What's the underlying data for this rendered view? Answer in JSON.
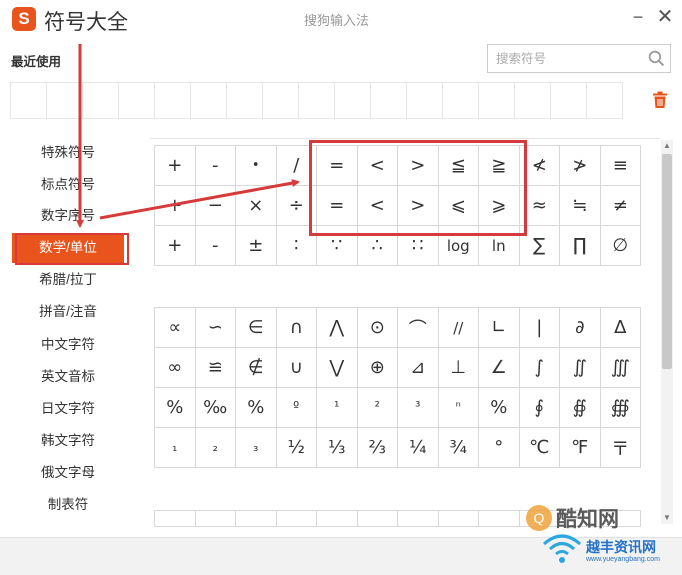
{
  "window": {
    "logo_letter": "S",
    "title": "符号大全",
    "subtitle": "搜狗输入法",
    "minimize_glyph": "−",
    "close_glyph": "✕"
  },
  "recent": {
    "label": "最近使用",
    "slot_count": 17,
    "clear_icon": "trash-icon"
  },
  "search": {
    "placeholder": "搜索符号",
    "value": "",
    "icon": "search-icon"
  },
  "sidebar": {
    "items": [
      {
        "label": "特殊符号"
      },
      {
        "label": "标点符号"
      },
      {
        "label": "数字序号"
      },
      {
        "label": "数学/单位",
        "active": true
      },
      {
        "label": "希腊/拉丁"
      },
      {
        "label": "拼音/注音"
      },
      {
        "label": "中文字符"
      },
      {
        "label": "英文音标"
      },
      {
        "label": "日文字符"
      },
      {
        "label": "韩文字符"
      },
      {
        "label": "俄文字母"
      },
      {
        "label": "制表符"
      }
    ]
  },
  "symbols": {
    "group1": [
      "+",
      "-",
      "•",
      "/",
      "=",
      "<",
      ">",
      "≦",
      "≧",
      "≮",
      "≯",
      "≡",
      "+",
      "−",
      "×",
      "÷",
      "=",
      "<",
      ">",
      "⩽",
      "⩾",
      "≈",
      "≒",
      "≠",
      "+",
      "-",
      "±",
      "∶",
      "∵",
      "∴",
      "∷",
      "log",
      "ln",
      "∑",
      "∏",
      "∅"
    ],
    "group2": [
      "∝",
      "∽",
      "∈",
      "∩",
      "⋀",
      "⊙",
      "⌒",
      "//",
      "∟",
      "|",
      "∂",
      "∆",
      "∞",
      "≌",
      "∉",
      "∪",
      "⋁",
      "⊕",
      "⊿",
      "⊥",
      "∠",
      "∫",
      "∬",
      "∭",
      "%",
      "‰",
      "%",
      "º",
      "¹",
      "²",
      "³",
      "ⁿ",
      "%",
      "∮",
      "∯",
      "∰",
      "₁",
      "₂",
      "₃",
      "½",
      "⅓",
      "⅔",
      "¼",
      "¾",
      "°",
      "℃",
      "℉",
      "〒"
    ]
  },
  "annotation": {
    "color": "#d63a3a"
  },
  "watermark": {
    "text": "酷知网",
    "text2": "越丰资讯网",
    "url": "www.yueyangbang.com"
  },
  "colors": {
    "accent": "#e8541c",
    "annotation": "#d63a3a"
  }
}
